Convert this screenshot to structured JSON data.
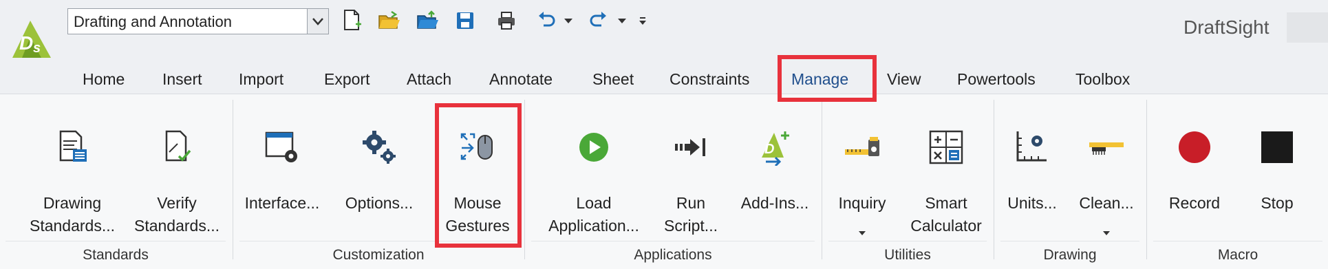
{
  "quick_access": {
    "workspace_value": "Drafting and Annotation",
    "app_name": "DraftSight"
  },
  "tabs": [
    {
      "label": "Home"
    },
    {
      "label": "Insert"
    },
    {
      "label": "Import"
    },
    {
      "label": "Export"
    },
    {
      "label": "Attach"
    },
    {
      "label": "Annotate"
    },
    {
      "label": "Sheet"
    },
    {
      "label": "Constraints"
    },
    {
      "label": "Manage",
      "active": true
    },
    {
      "label": "View"
    },
    {
      "label": "Powertools"
    },
    {
      "label": "Toolbox"
    }
  ],
  "groups": {
    "standards": {
      "label": "Standards",
      "buttons": [
        {
          "label_line1": "Drawing",
          "label_line2": "Standards...",
          "icon": "drawing-standards-icon"
        },
        {
          "label_line1": "Verify",
          "label_line2": "Standards...",
          "icon": "verify-standards-icon"
        }
      ]
    },
    "customization": {
      "label": "Customization",
      "buttons": [
        {
          "label_line1": "Interface...",
          "label_line2": "",
          "icon": "interface-icon"
        },
        {
          "label_line1": "Options...",
          "label_line2": "",
          "icon": "options-gears-icon"
        },
        {
          "label_line1": "Mouse",
          "label_line2": "Gestures",
          "icon": "mouse-gestures-icon"
        }
      ]
    },
    "applications": {
      "label": "Applications",
      "buttons": [
        {
          "label_line1": "Load",
          "label_line2": "Application...",
          "icon": "load-application-icon"
        },
        {
          "label_line1": "Run",
          "label_line2": "Script...",
          "icon": "run-script-icon"
        },
        {
          "label_line1": "Add-Ins...",
          "label_line2": "",
          "icon": "add-ins-icon"
        }
      ]
    },
    "utilities": {
      "label": "Utilities",
      "buttons": [
        {
          "label_line1": "Inquiry",
          "label_line2": "",
          "icon": "inquiry-icon"
        },
        {
          "label_line1": "Smart",
          "label_line2": "Calculator",
          "icon": "smart-calculator-icon"
        }
      ]
    },
    "drawing": {
      "label": "Drawing",
      "buttons": [
        {
          "label_line1": "Units...",
          "label_line2": "",
          "icon": "units-icon"
        },
        {
          "label_line1": "Clean...",
          "label_line2": "",
          "icon": "clean-icon"
        }
      ]
    },
    "macro": {
      "label": "Macro",
      "buttons": [
        {
          "label_line1": "Record",
          "label_line2": "",
          "icon": "record-icon"
        },
        {
          "label_line1": "Stop",
          "label_line2": "",
          "icon": "stop-icon"
        }
      ]
    }
  },
  "colors": {
    "accent_blue": "#1f4e8c",
    "highlight_red": "#e8323c",
    "record_red": "#c81e28",
    "play_green": "#4aa838"
  }
}
